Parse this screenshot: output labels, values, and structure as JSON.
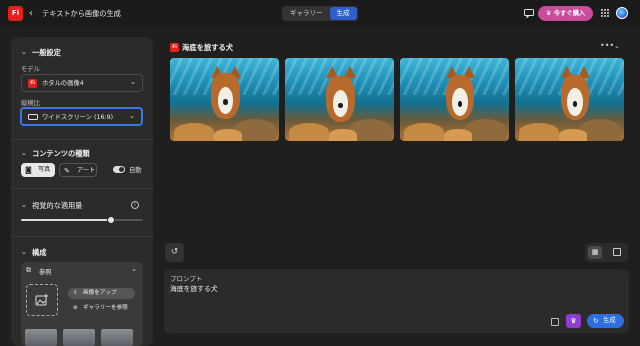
{
  "topbar": {
    "logo": "Fi",
    "back_icon": "‹",
    "title": "テキストから画像の生成",
    "tabs": [
      {
        "label": "ギャラリー",
        "active": false
      },
      {
        "label": "生成",
        "active": true
      }
    ],
    "buy_label": "今すぐ購入",
    "buy_icon": "♛"
  },
  "panel": {
    "general": {
      "title": "一般設定",
      "model_label": "モデル",
      "model_value": "ホタルの画像4",
      "aspect_label": "縦横比",
      "aspect_value": "ワイドスクリーン (16:9)"
    },
    "content_type": {
      "title": "コンテンツの種類",
      "photo_label": "写真",
      "art_label": "アート",
      "auto_label": "自動",
      "selected": "写真"
    },
    "visual_intensity": {
      "title": "視覚的な適用量",
      "value": 0.74
    },
    "composition": {
      "title": "構成",
      "reference_label": "参照",
      "upload_label": "画像をアップ",
      "gallery_label": "ギャラリーを参照"
    }
  },
  "results": {
    "logo": "Fi",
    "title": "海底を旅する犬",
    "more_icon": "•••",
    "collapse_icon": "⌄",
    "images": [
      {
        "alt": "dog underwater 1"
      },
      {
        "alt": "dog underwater 2"
      },
      {
        "alt": "dog underwater 3"
      },
      {
        "alt": "dog underwater 4"
      }
    ]
  },
  "prompt": {
    "label": "プロンプト",
    "text": "海底を旅する犬",
    "generate_label": "生成"
  },
  "colors": {
    "accent": "#2c6fe0",
    "brand": "#e3201b",
    "buy": "#c84c9a"
  }
}
